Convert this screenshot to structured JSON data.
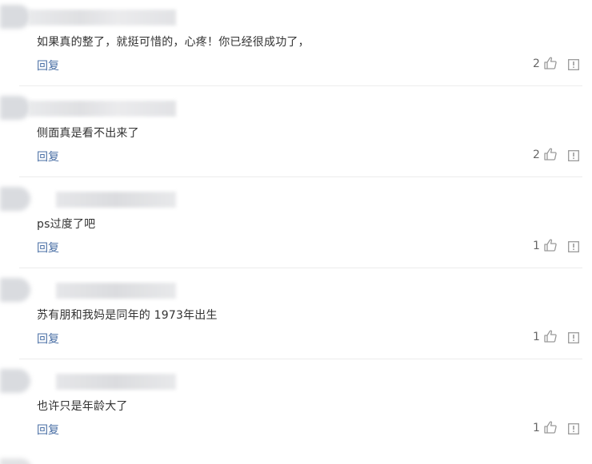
{
  "comments": [
    {
      "text": "如果真的整了，就挺可惜的，心疼！你已经很成功了，",
      "reply_label": "回复",
      "likes": "2"
    },
    {
      "text": "侧面真是看不出来了",
      "reply_label": "回复",
      "likes": "2"
    },
    {
      "text": "ps过度了吧",
      "reply_label": "回复",
      "likes": "1"
    },
    {
      "text": "苏有朋和我妈是同年的 1973年出生",
      "reply_label": "回复",
      "likes": "1"
    },
    {
      "text": "也许只是年龄大了",
      "reply_label": "回复",
      "likes": "1"
    }
  ],
  "icons": {
    "like": "thumbs-up-icon",
    "report": "report-icon"
  },
  "colors": {
    "text": "#333333",
    "reply_link": "#4a6fa5",
    "count": "#666666",
    "icon": "#9a9a9a",
    "divider": "#ececec"
  }
}
